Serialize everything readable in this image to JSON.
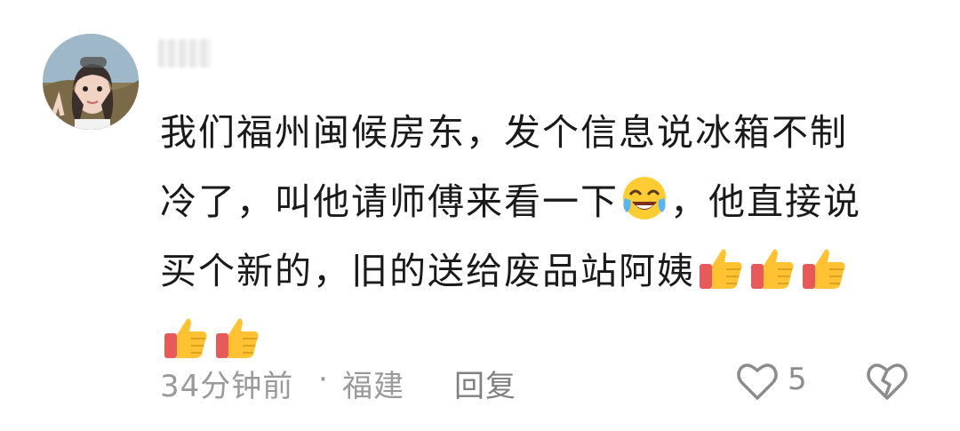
{
  "comment": {
    "text_line1": "我们福州闽候房东，发个信息说冰箱不制",
    "text_line2a": "冷了，叫他请师傅来看一下",
    "text_line2b": "，他直接说",
    "text_line3": "买个新的，旧的送给废品站阿姨",
    "emojis": {
      "laugh": "laughing-crying-emoji",
      "thumbs": [
        "thumbs-up-emoji",
        "thumbs-up-emoji",
        "thumbs-up-emoji",
        "thumbs-up-emoji",
        "thumbs-up-emoji"
      ]
    }
  },
  "footer": {
    "time": "34分钟前",
    "separator": "·",
    "location": "福建",
    "reply_label": "回复",
    "like_count": "5"
  },
  "icons": {
    "like": "heart-outline-icon",
    "dislike": "broken-heart-outline-icon"
  },
  "colors": {
    "text": "#1a1a1a",
    "meta": "#9a9a9a",
    "icon": "#8c8c8c"
  }
}
